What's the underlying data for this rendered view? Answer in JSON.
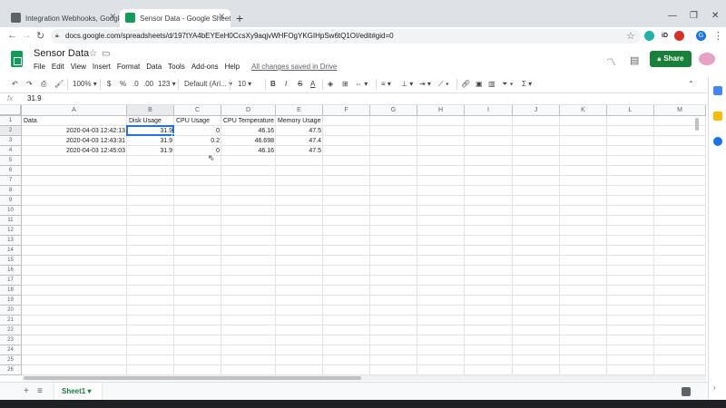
{
  "browser": {
    "tabs": [
      {
        "title": "Integration Webhooks, Google S",
        "active": false,
        "favicon_color": "#5f6368"
      },
      {
        "title": "Sensor Data - Google Sheets",
        "active": true,
        "favicon_color": "#0f9d58"
      }
    ],
    "url": "docs.google.com/spreadsheets/d/197tYA4bEYEeH0CcsXy9aqjvWHFOgYKGIHpSw6tQ1OI/edit#gid=0"
  },
  "doc": {
    "title": "Sensor Data",
    "menus": [
      "File",
      "Edit",
      "View",
      "Insert",
      "Format",
      "Data",
      "Tools",
      "Add-ons",
      "Help"
    ],
    "save_status": "All changes saved in Drive",
    "share_label": "Share"
  },
  "toolbar": {
    "zoom": "100%",
    "currency": "$",
    "percent": "%",
    "dec_decrease": ".0",
    "dec_increase": ".00",
    "more_formats": "123",
    "font": "Default (Ari...",
    "font_size": "10",
    "bold": "B",
    "italic": "I",
    "strike": "S",
    "text_color": "A"
  },
  "formula_bar": {
    "fx": "fx",
    "value": "31.9"
  },
  "sheet": {
    "columns": [
      "A",
      "B",
      "C",
      "D",
      "E",
      "F",
      "G",
      "H",
      "I",
      "J",
      "K",
      "L",
      "M"
    ],
    "rows": [
      "1",
      "2",
      "3",
      "4",
      "5",
      "6",
      "7",
      "8",
      "9",
      "10",
      "11",
      "12",
      "13",
      "14",
      "15",
      "16",
      "17",
      "18",
      "19",
      "20",
      "21",
      "22",
      "23",
      "24",
      "25",
      "26"
    ],
    "headers": [
      "Data",
      "Disk Usage",
      "CPU Usage",
      "CPU Temperature",
      "Memory Usage"
    ],
    "data": [
      [
        "2020-04-03 12:42:13",
        "31.9",
        "0",
        "46.16",
        "47.5"
      ],
      [
        "2020-04-03 12:43:31",
        "31.9",
        "0.2",
        "46.698",
        "47.4"
      ],
      [
        "2020-04-03 12:45:03",
        "31.9",
        "0",
        "46.16",
        "47.5"
      ]
    ],
    "selected_cell": "B2",
    "tab_name": "Sheet1"
  },
  "colors": {
    "accent": "#1a73e8",
    "sheets_green": "#188038",
    "share": "#188038"
  }
}
